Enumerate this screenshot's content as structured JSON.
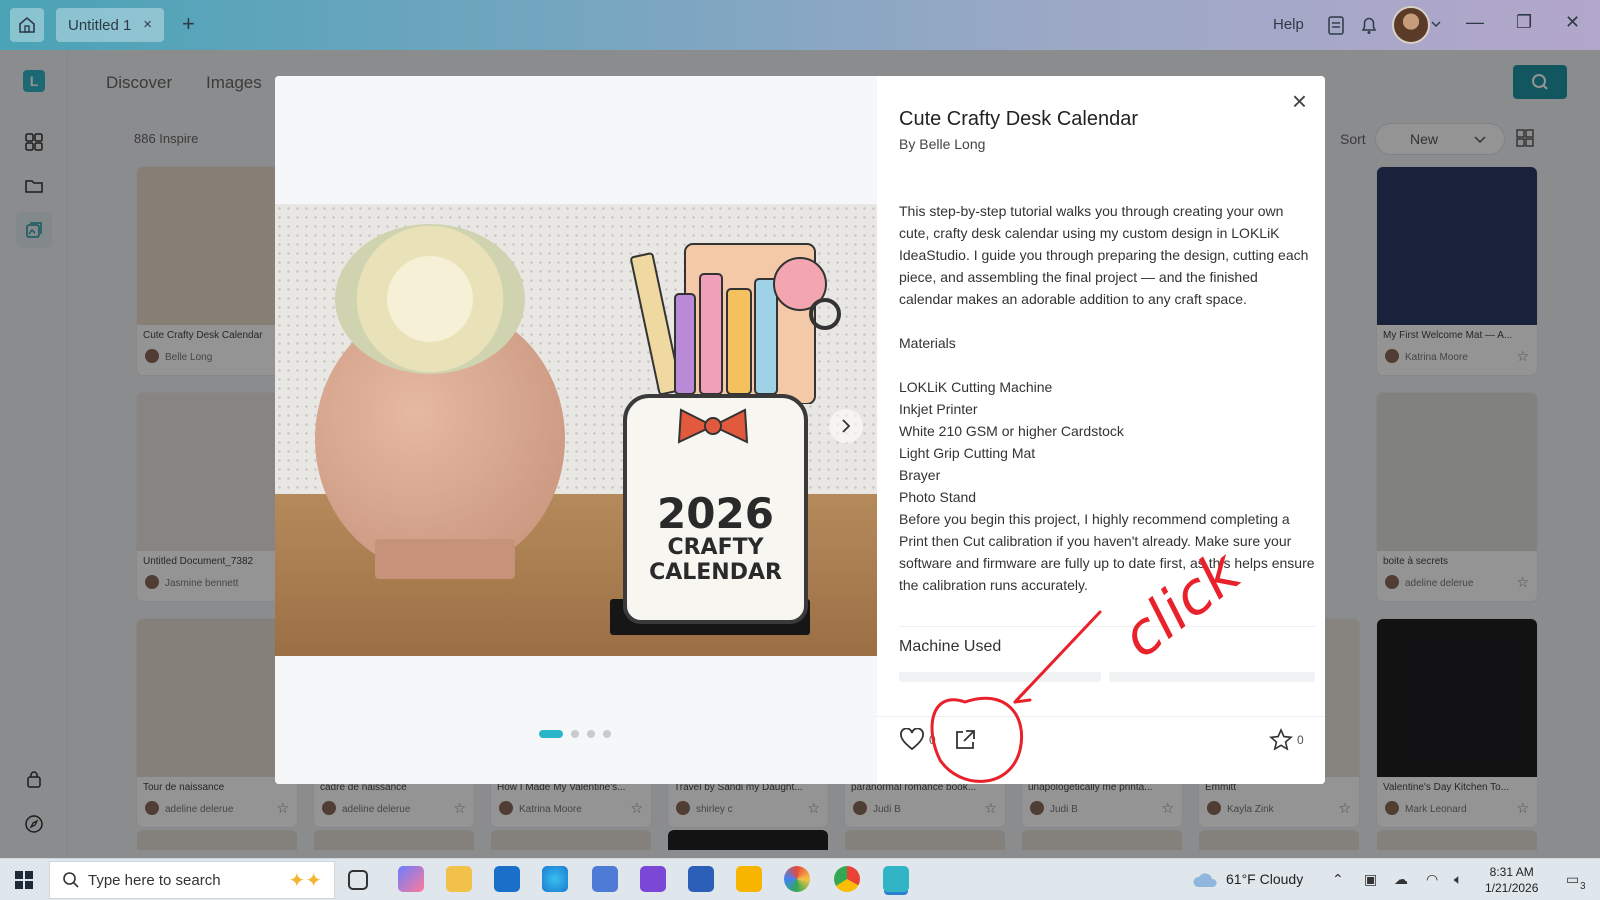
{
  "window": {
    "tab_title": "Untitled 1",
    "tab_close": "×",
    "add_tab": "+",
    "help": "Help",
    "minimize": "—",
    "restore": "❐",
    "close": "✕"
  },
  "nav": {
    "discover": "Discover",
    "images": "Images"
  },
  "toolbar": {
    "inspire_count": "886 Inspire",
    "sort_label": "Sort",
    "sort_value": "New"
  },
  "cards": [
    {
      "title": "Cute Crafty Desk Calendar",
      "author": "Belle Long",
      "thumb": "#e8d9cc"
    },
    {
      "title": "Untitled Document_7382",
      "author": "Jasmine  bennett",
      "thumb": "#e9e3e2"
    },
    {
      "title": "Tour de naissance",
      "author": "adeline delerue",
      "thumb": "#e6ddd2"
    },
    {
      "title": "My First Welcome Mat — A...",
      "author": "Katrina Moore",
      "thumb": "#2d3b66"
    },
    {
      "title": "boite à secrets",
      "author": "adeline delerue",
      "thumb": "#dfe1d8"
    },
    {
      "title": "Valentine's Day Kitchen To...",
      "author": "Mark Leonard",
      "thumb": "#1f1f22"
    },
    {
      "title": "cadre de naissance",
      "author": "adeline delerue",
      "thumb": "#e8e2db"
    },
    {
      "title": "How I Made My Valentine's...",
      "author": "Katrina Moore",
      "thumb": "#e8e2db"
    },
    {
      "title": "Travel by Sandi my Daught...",
      "author": "shirley c",
      "thumb": "#e8e2db"
    },
    {
      "title": "paranormal romance book...",
      "author": "Judi B",
      "thumb": "#e8e2db"
    },
    {
      "title": "unapologetically me printa...",
      "author": "Judi B",
      "thumb": "#e8e2db"
    },
    {
      "title": "Emmitt",
      "author": "Kayla Zink",
      "thumb": "#e8e2db"
    }
  ],
  "modal": {
    "title": "Cute Crafty Desk Calendar",
    "author": "By Belle Long",
    "close": "×",
    "description": "This step-by-step tutorial walks you through creating your own cute, crafty desk calendar using my custom design in LOKLiK IdeaStudio. I guide you through preparing the design, cutting each piece, and assembling the final project — and the finished calendar makes an adorable addition to any craft space.",
    "materials_heading": "Materials",
    "materials": [
      "LOKLiK Cutting Machine",
      "Inkjet Printer",
      "White 210 GSM or higher Cardstock",
      "Light Grip Cutting Mat",
      "Brayer",
      "Photo Stand"
    ],
    "note": "Before you begin this project, I highly recommend completing a Print then Cut calibration if you haven't already. Make sure your software and firmware are fully up to date first, as this helps ensure the calibration runs accurately.",
    "machine_used": "Machine Used",
    "like_count": "0",
    "star_count": "0",
    "hero": {
      "year": "2026",
      "line1": "CRAFTY",
      "line2": "CALENDAR"
    },
    "slides": 4,
    "active_slide": 0
  },
  "annotation": {
    "text": "click",
    "color": "#e8212a"
  },
  "taskbar": {
    "search_placeholder": "Type here to search",
    "weather": "61°F  Cloudy",
    "time": "8:31 AM",
    "date": "1/21/2026",
    "notif_count": "3"
  },
  "colors": {
    "accent": "#29b6c8",
    "search_button": "#1f96a5"
  }
}
